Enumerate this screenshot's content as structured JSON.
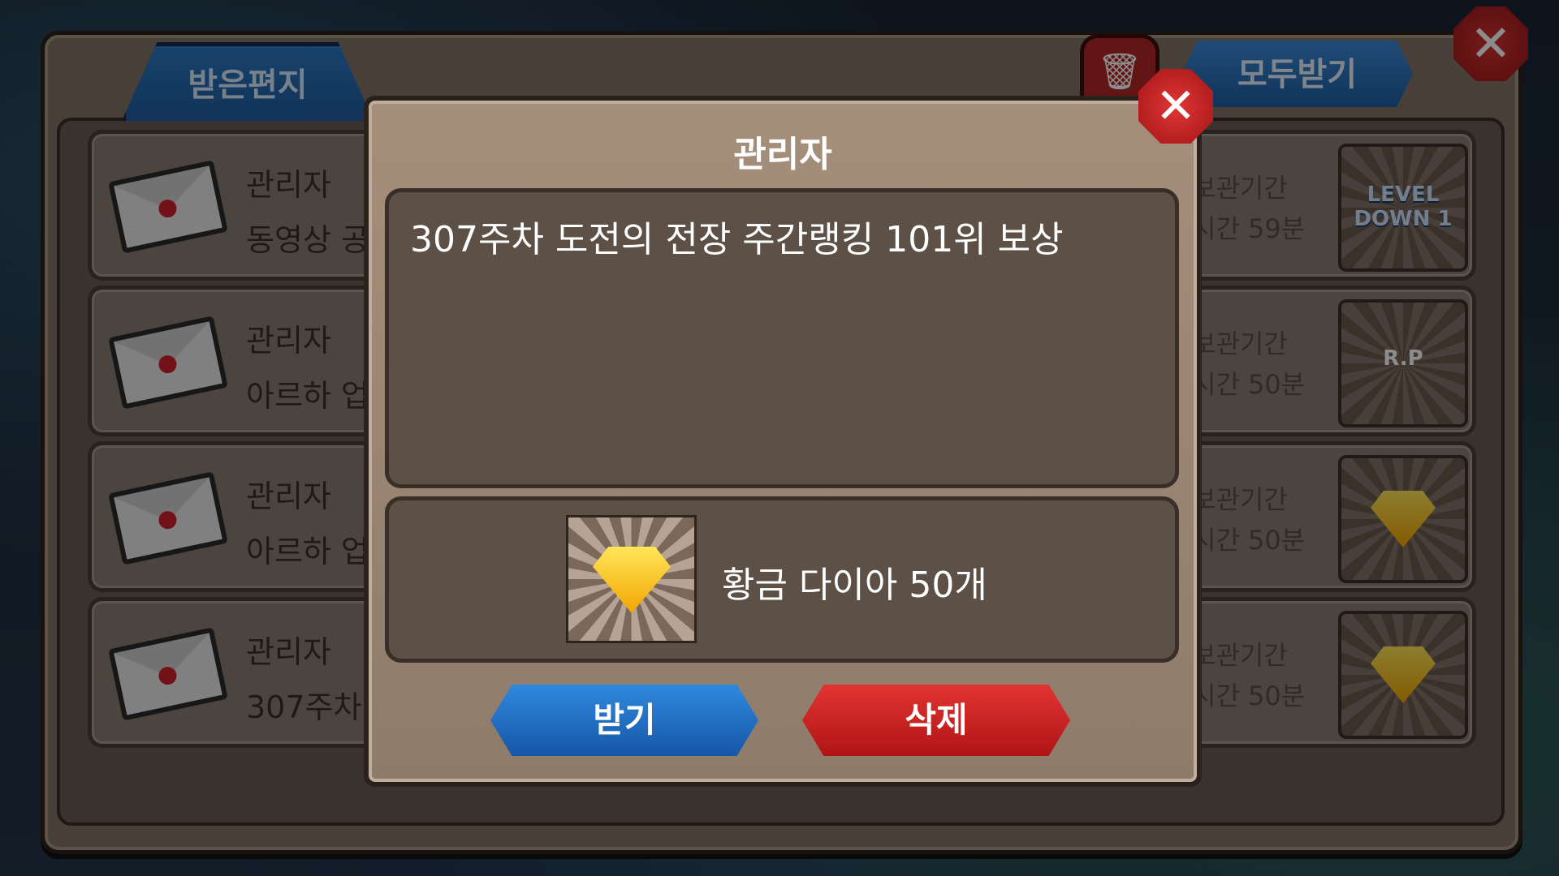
{
  "tabs": {
    "received": "받은편지"
  },
  "toolbar": {
    "receive_all": "모두받기",
    "trash_icon": "trash-icon",
    "close_icon": "close-icon"
  },
  "mail_rows": [
    {
      "sender": "관리자",
      "subject": "동영상 공",
      "expire_label": "보관기간",
      "time_left": "시간 59분",
      "reward": "LEVEL DOWN 1"
    },
    {
      "sender": "관리자",
      "subject": "아르하 업",
      "expire_label": "보관기간",
      "time_left": "시간 50분",
      "reward": "R.P"
    },
    {
      "sender": "관리자",
      "subject": "아르하 업",
      "expire_label": "보관기간",
      "time_left": "시간 50분",
      "reward": "gold-diamond"
    },
    {
      "sender": "관리자",
      "subject": "307주차",
      "expire_label": "보관기간",
      "time_left": "시간 50분",
      "reward": "gold-diamond"
    }
  ],
  "modal": {
    "title": "관리자",
    "message": "307주차 도전의 전장 주간랭킹 101위 보상",
    "reward_text": "황금 다이아 50개",
    "receive_label": "받기",
    "delete_label": "삭제"
  },
  "colors": {
    "receive": "#1f5fa4",
    "delete": "#b01414",
    "panel": "#837467"
  }
}
